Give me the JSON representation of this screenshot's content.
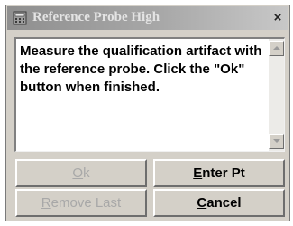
{
  "window": {
    "title": "Reference Probe High",
    "close_glyph": "×",
    "app_icon": "calculator-icon"
  },
  "message": {
    "text": "Measure the qualification artifact with the reference probe. Click the \"Ok\" button when finished."
  },
  "buttons": {
    "ok": {
      "accel": "O",
      "rest": "k",
      "enabled": false
    },
    "enter_pt": {
      "accel": "E",
      "rest": "nter Pt",
      "enabled": true
    },
    "remove_last": {
      "accel": "R",
      "rest": "emove Last",
      "enabled": false
    },
    "cancel": {
      "accel": "C",
      "rest": "ancel",
      "enabled": true
    }
  }
}
